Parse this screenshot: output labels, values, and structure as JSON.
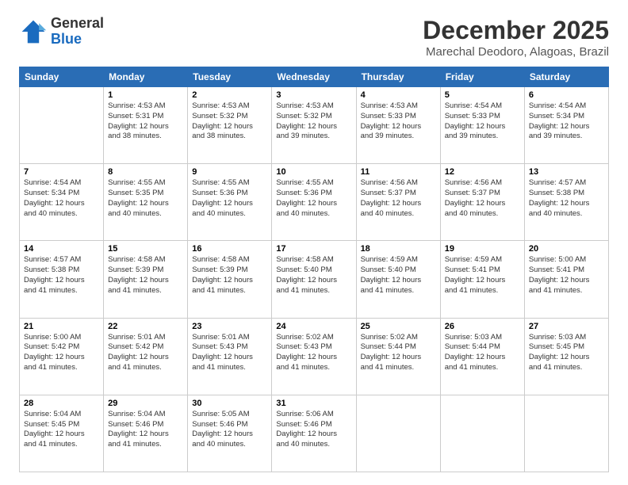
{
  "header": {
    "logo": {
      "general": "General",
      "blue": "Blue"
    },
    "title": "December 2025",
    "subtitle": "Marechal Deodoro, Alagoas, Brazil"
  },
  "weekdays": [
    "Sunday",
    "Monday",
    "Tuesday",
    "Wednesday",
    "Thursday",
    "Friday",
    "Saturday"
  ],
  "weeks": [
    [
      {
        "day": "",
        "info": ""
      },
      {
        "day": "1",
        "info": "Sunrise: 4:53 AM\nSunset: 5:31 PM\nDaylight: 12 hours\nand 38 minutes."
      },
      {
        "day": "2",
        "info": "Sunrise: 4:53 AM\nSunset: 5:32 PM\nDaylight: 12 hours\nand 38 minutes."
      },
      {
        "day": "3",
        "info": "Sunrise: 4:53 AM\nSunset: 5:32 PM\nDaylight: 12 hours\nand 39 minutes."
      },
      {
        "day": "4",
        "info": "Sunrise: 4:53 AM\nSunset: 5:33 PM\nDaylight: 12 hours\nand 39 minutes."
      },
      {
        "day": "5",
        "info": "Sunrise: 4:54 AM\nSunset: 5:33 PM\nDaylight: 12 hours\nand 39 minutes."
      },
      {
        "day": "6",
        "info": "Sunrise: 4:54 AM\nSunset: 5:34 PM\nDaylight: 12 hours\nand 39 minutes."
      }
    ],
    [
      {
        "day": "7",
        "info": "Sunrise: 4:54 AM\nSunset: 5:34 PM\nDaylight: 12 hours\nand 40 minutes."
      },
      {
        "day": "8",
        "info": "Sunrise: 4:55 AM\nSunset: 5:35 PM\nDaylight: 12 hours\nand 40 minutes."
      },
      {
        "day": "9",
        "info": "Sunrise: 4:55 AM\nSunset: 5:36 PM\nDaylight: 12 hours\nand 40 minutes."
      },
      {
        "day": "10",
        "info": "Sunrise: 4:55 AM\nSunset: 5:36 PM\nDaylight: 12 hours\nand 40 minutes."
      },
      {
        "day": "11",
        "info": "Sunrise: 4:56 AM\nSunset: 5:37 PM\nDaylight: 12 hours\nand 40 minutes."
      },
      {
        "day": "12",
        "info": "Sunrise: 4:56 AM\nSunset: 5:37 PM\nDaylight: 12 hours\nand 40 minutes."
      },
      {
        "day": "13",
        "info": "Sunrise: 4:57 AM\nSunset: 5:38 PM\nDaylight: 12 hours\nand 40 minutes."
      }
    ],
    [
      {
        "day": "14",
        "info": "Sunrise: 4:57 AM\nSunset: 5:38 PM\nDaylight: 12 hours\nand 41 minutes."
      },
      {
        "day": "15",
        "info": "Sunrise: 4:58 AM\nSunset: 5:39 PM\nDaylight: 12 hours\nand 41 minutes."
      },
      {
        "day": "16",
        "info": "Sunrise: 4:58 AM\nSunset: 5:39 PM\nDaylight: 12 hours\nand 41 minutes."
      },
      {
        "day": "17",
        "info": "Sunrise: 4:58 AM\nSunset: 5:40 PM\nDaylight: 12 hours\nand 41 minutes."
      },
      {
        "day": "18",
        "info": "Sunrise: 4:59 AM\nSunset: 5:40 PM\nDaylight: 12 hours\nand 41 minutes."
      },
      {
        "day": "19",
        "info": "Sunrise: 4:59 AM\nSunset: 5:41 PM\nDaylight: 12 hours\nand 41 minutes."
      },
      {
        "day": "20",
        "info": "Sunrise: 5:00 AM\nSunset: 5:41 PM\nDaylight: 12 hours\nand 41 minutes."
      }
    ],
    [
      {
        "day": "21",
        "info": "Sunrise: 5:00 AM\nSunset: 5:42 PM\nDaylight: 12 hours\nand 41 minutes."
      },
      {
        "day": "22",
        "info": "Sunrise: 5:01 AM\nSunset: 5:42 PM\nDaylight: 12 hours\nand 41 minutes."
      },
      {
        "day": "23",
        "info": "Sunrise: 5:01 AM\nSunset: 5:43 PM\nDaylight: 12 hours\nand 41 minutes."
      },
      {
        "day": "24",
        "info": "Sunrise: 5:02 AM\nSunset: 5:43 PM\nDaylight: 12 hours\nand 41 minutes."
      },
      {
        "day": "25",
        "info": "Sunrise: 5:02 AM\nSunset: 5:44 PM\nDaylight: 12 hours\nand 41 minutes."
      },
      {
        "day": "26",
        "info": "Sunrise: 5:03 AM\nSunset: 5:44 PM\nDaylight: 12 hours\nand 41 minutes."
      },
      {
        "day": "27",
        "info": "Sunrise: 5:03 AM\nSunset: 5:45 PM\nDaylight: 12 hours\nand 41 minutes."
      }
    ],
    [
      {
        "day": "28",
        "info": "Sunrise: 5:04 AM\nSunset: 5:45 PM\nDaylight: 12 hours\nand 41 minutes."
      },
      {
        "day": "29",
        "info": "Sunrise: 5:04 AM\nSunset: 5:46 PM\nDaylight: 12 hours\nand 41 minutes."
      },
      {
        "day": "30",
        "info": "Sunrise: 5:05 AM\nSunset: 5:46 PM\nDaylight: 12 hours\nand 40 minutes."
      },
      {
        "day": "31",
        "info": "Sunrise: 5:06 AM\nSunset: 5:46 PM\nDaylight: 12 hours\nand 40 minutes."
      },
      {
        "day": "",
        "info": ""
      },
      {
        "day": "",
        "info": ""
      },
      {
        "day": "",
        "info": ""
      }
    ]
  ]
}
